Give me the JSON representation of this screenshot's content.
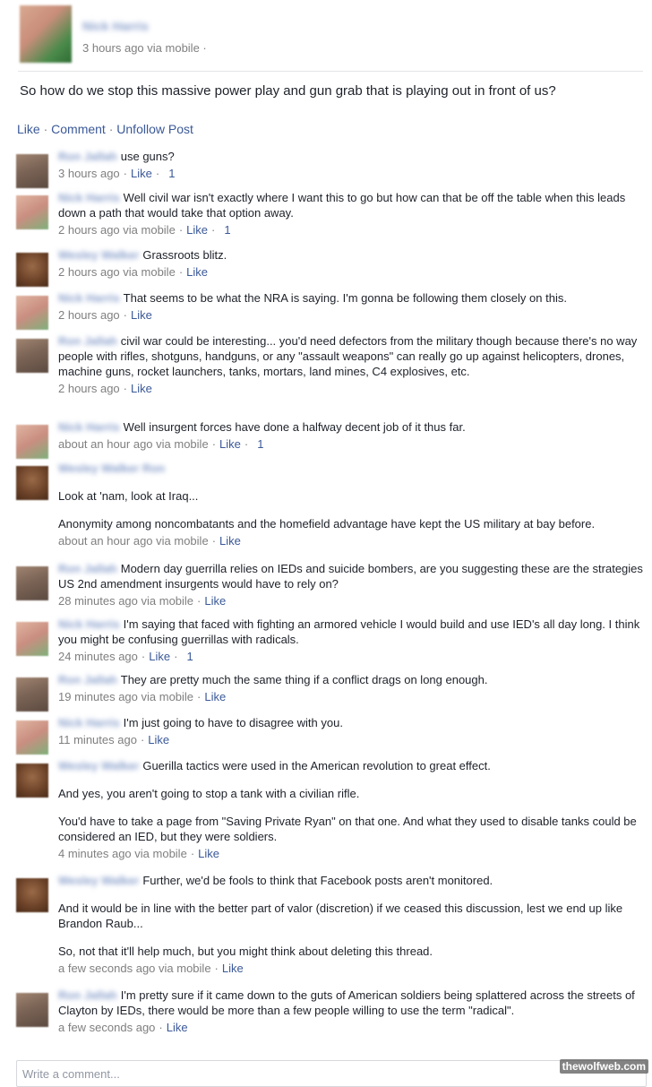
{
  "post": {
    "author": "Nick Harris",
    "meta": "3 hours ago via mobile ·",
    "text": "So how do we stop this massive power play and gun grab that is playing out in front of us?",
    "actions": {
      "like": "Like",
      "comment": "Comment",
      "unfollow": "Unfollow Post",
      "separator": "·"
    }
  },
  "comments": [
    {
      "author": "Ron Jallah",
      "avatar": "ron",
      "paragraphs": [
        "use guns?"
      ],
      "time": "3 hours ago",
      "like": "Like",
      "likes": "1"
    },
    {
      "author": "Nick Harris",
      "avatar": "nick",
      "paragraphs": [
        "Well civil war isn't exactly where I want this to go but how can that be off the table when this leads down a path that would take that option away."
      ],
      "time": "2 hours ago via mobile",
      "like": "Like",
      "likes": "1"
    },
    {
      "author": "Wesley Walker",
      "avatar": "wesley",
      "paragraphs": [
        "Grassroots blitz."
      ],
      "time": "2 hours ago via mobile",
      "like": "Like",
      "likes": ""
    },
    {
      "author": "Nick Harris",
      "avatar": "nick",
      "paragraphs": [
        "That seems to be what the NRA is saying. I'm gonna be following them closely on this."
      ],
      "time": "2 hours ago",
      "like": "Like",
      "likes": ""
    },
    {
      "author": "Ron Jallah",
      "avatar": "ron",
      "paragraphs": [
        "civil war could be interesting... you'd need defectors from the military though because there's no way people with rifles, shotguns, handguns, or any \"assault weapons\" can really go up against helicopters, drones, machine guns, rocket launchers, tanks, mortars, land mines, C4 explosives, etc."
      ],
      "time": "2 hours ago",
      "like": "Like",
      "likes": ""
    },
    {
      "author": "Nick Harris",
      "avatar": "nick",
      "paragraphs": [
        "Well insurgent forces have done a halfway decent job of it thus far."
      ],
      "time": "about an hour ago via mobile",
      "like": "Like",
      "likes": "1"
    },
    {
      "author": "Wesley Walker Ron",
      "avatar": "wesley",
      "paragraphs": [
        "",
        "Look at 'nam, look at Iraq...",
        "Anonymity among noncombatants and the homefield advantage have kept the US military at bay before."
      ],
      "time": "about an hour ago via mobile",
      "like": "Like",
      "likes": ""
    },
    {
      "author": "Ron Jallah",
      "avatar": "ron",
      "paragraphs": [
        "Modern day guerrilla relies on IEDs and suicide bombers, are you suggesting these are the strategies US 2nd amendment insurgents would have to rely on?"
      ],
      "time": "28 minutes ago via mobile",
      "like": "Like",
      "likes": ""
    },
    {
      "author": "Nick Harris",
      "avatar": "nick",
      "paragraphs": [
        "I'm saying that faced with fighting an armored vehicle I would build and use IED's all day long. I think you might be confusing guerrillas with radicals."
      ],
      "time": "24 minutes ago",
      "like": "Like",
      "likes": "1"
    },
    {
      "author": "Ron Jallah",
      "avatar": "ron",
      "paragraphs": [
        "They are pretty much the same thing if a conflict drags on long enough."
      ],
      "time": "19 minutes ago via mobile",
      "like": "Like",
      "likes": ""
    },
    {
      "author": "Nick Harris",
      "avatar": "nick",
      "paragraphs": [
        "I'm just going to have to disagree with you."
      ],
      "time": "11 minutes ago",
      "like": "Like",
      "likes": ""
    },
    {
      "author": "Wesley Walker",
      "avatar": "wesley",
      "paragraphs": [
        "Guerilla tactics were used in the American revolution to great effect.",
        "And yes, you aren't going to stop a tank with a civilian rifle.",
        "You'd have to take a page from \"Saving Private Ryan\" on that one. And what they used to disable tanks could be considered an IED, but they were soldiers."
      ],
      "time": "4 minutes ago via mobile",
      "like": "Like",
      "likes": ""
    },
    {
      "author": "Wesley Walker",
      "avatar": "wesley",
      "paragraphs": [
        "Further, we'd be fools to think that Facebook posts aren't monitored.",
        "And it would be in line with the better part of valor (discretion) if we ceased this discussion, lest we end up like Brandon Raub...",
        "So, not that it'll help much, but you might think about deleting this thread."
      ],
      "time": "a few seconds ago via mobile",
      "like": "Like",
      "likes": ""
    },
    {
      "author": "Ron Jallah",
      "avatar": "ron",
      "paragraphs": [
        "I'm pretty sure if it came down to the guts of American soldiers being splattered across the streets of Clayton by IEDs, there would be more than a few people willing to use the term \"radical\"."
      ],
      "time": "a few seconds ago",
      "like": "Like",
      "likes": ""
    }
  ],
  "compose": {
    "placeholder": "Write a comment..."
  },
  "watermark": "thewolfweb.com"
}
